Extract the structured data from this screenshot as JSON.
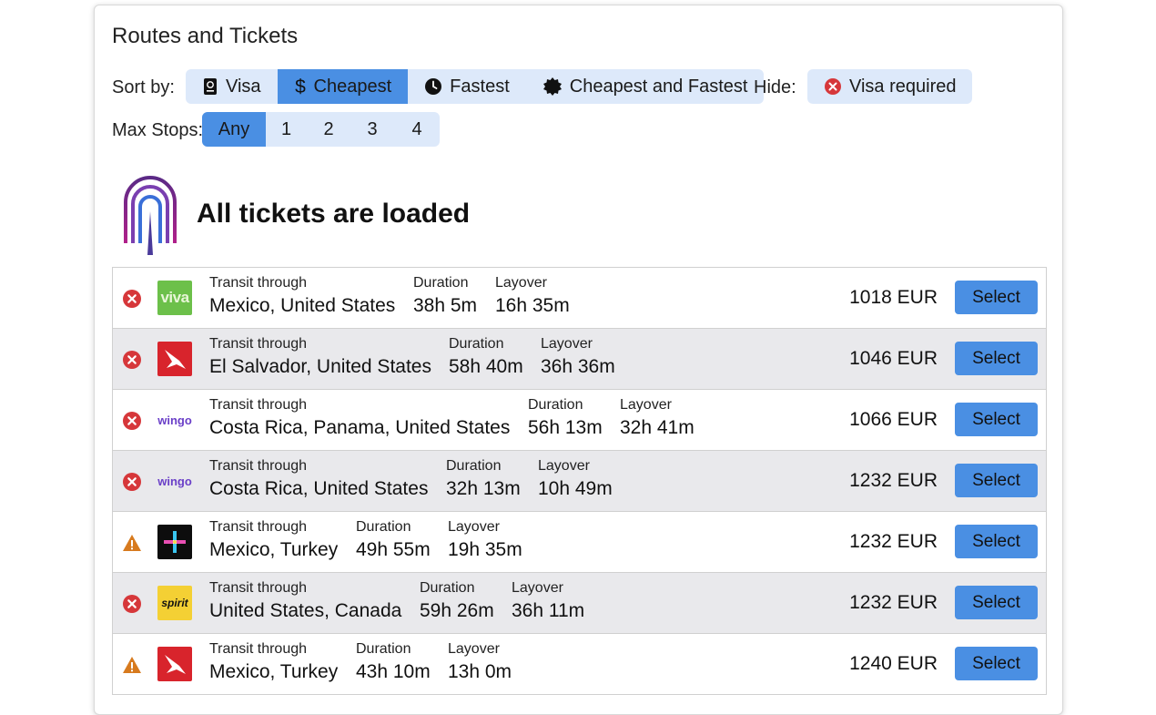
{
  "title": "Routes and Tickets",
  "sort": {
    "label": "Sort by:",
    "options": [
      {
        "label": "Visa",
        "icon": "passport-icon",
        "active": false
      },
      {
        "label": "Cheapest",
        "icon": "dollar-icon",
        "active": true
      },
      {
        "label": "Fastest",
        "icon": "clock-icon",
        "active": false
      },
      {
        "label": "Cheapest and Fastest",
        "icon": "badge-icon",
        "active": false
      }
    ]
  },
  "hide": {
    "label": "Hide:",
    "option": {
      "label": "Visa required",
      "icon": "red-x-icon"
    }
  },
  "stops": {
    "label": "Max Stops:",
    "options": [
      "Any",
      "1",
      "2",
      "3",
      "4"
    ],
    "active_index": 0
  },
  "status_message": "All tickets are loaded",
  "labels": {
    "transit": "Transit through",
    "duration": "Duration",
    "layover": "Layover",
    "select": "Select"
  },
  "colors": {
    "accent": "#4a8fe3",
    "segment_bg": "#dde9fa",
    "error_red": "#d6373a",
    "warning_orange": "#d77a1e"
  },
  "tickets": [
    {
      "status": "visa-required",
      "airline": "viva",
      "transit": "Mexico, United States",
      "duration": "38h 5m",
      "layover": "16h 35m",
      "price": "1018 EUR"
    },
    {
      "status": "visa-required",
      "airline": "avianca",
      "transit": "El Salvador, United States",
      "duration": "58h 40m",
      "layover": "36h 36m",
      "price": "1046 EUR"
    },
    {
      "status": "visa-required",
      "airline": "wingo",
      "transit": "Costa Rica, Panama, United States",
      "duration": "56h 13m",
      "layover": "32h 41m",
      "price": "1066 EUR"
    },
    {
      "status": "visa-required",
      "airline": "wingo",
      "transit": "Costa Rica, United States",
      "duration": "32h 13m",
      "layover": "10h 49m",
      "price": "1232 EUR"
    },
    {
      "status": "warning",
      "airline": "cross",
      "transit": "Mexico, Turkey",
      "duration": "49h 55m",
      "layover": "19h 35m",
      "price": "1232 EUR"
    },
    {
      "status": "visa-required",
      "airline": "spirit",
      "transit": "United States, Canada",
      "duration": "59h 26m",
      "layover": "36h 11m",
      "price": "1232 EUR"
    },
    {
      "status": "warning",
      "airline": "avianca",
      "transit": "Mexico, Turkey",
      "duration": "43h 10m",
      "layover": "13h 0m",
      "price": "1240 EUR"
    }
  ],
  "airline_logo_text": {
    "viva": "viva",
    "wingo": "wingo",
    "spirit": "spirit"
  }
}
